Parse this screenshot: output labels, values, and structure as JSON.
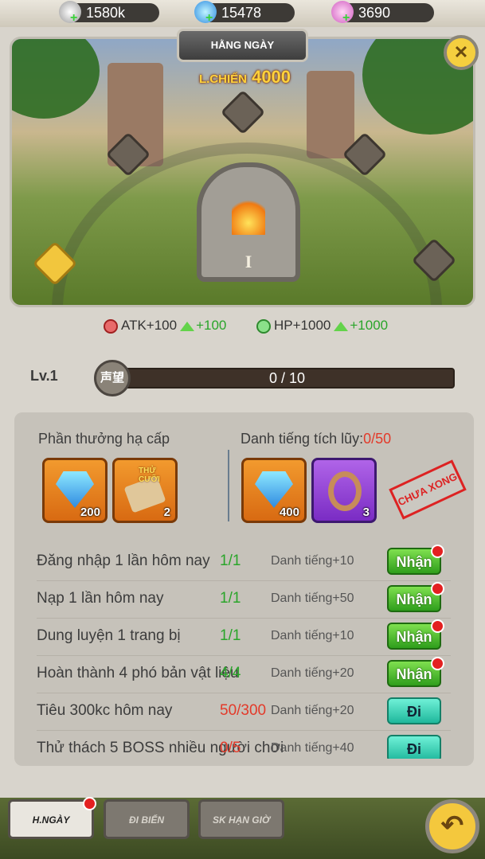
{
  "currencies": [
    {
      "name": "silver-coin",
      "value": "1580k",
      "color": "#b9b9b9"
    },
    {
      "name": "diamond",
      "value": "15478",
      "color": "#3aa7e8"
    },
    {
      "name": "shell",
      "value": "3690",
      "color": "#e98ad6"
    }
  ],
  "header": {
    "title": "HẰNG NGÀY",
    "power_label": "L.CHIẾN",
    "power_value": "4000"
  },
  "scene": {
    "stage_numeral": "I"
  },
  "stats": {
    "atk_label": "ATK+100",
    "atk_bonus": "+100",
    "hp_label": "HP+1000",
    "hp_bonus": "+1000"
  },
  "progress": {
    "level": "Lv.1",
    "badge": "声望",
    "text": "0 / 10",
    "value": 0,
    "max": 10
  },
  "rewards": {
    "lower_title": "Phần thưởng hạ cấp",
    "lower_items": [
      {
        "icon": "diamond-icon",
        "count": "200"
      },
      {
        "icon": "scroll-icon",
        "count": "2",
        "tag": "THỬ CƯỠI"
      }
    ],
    "accum_title": "Danh tiếng tích lũy:",
    "accum_progress": "0/50",
    "accum_items": [
      {
        "icon": "diamond-icon",
        "count": "400"
      },
      {
        "icon": "rope-icon",
        "count": "3"
      }
    ],
    "stamp": "CHƯA XONG"
  },
  "tasks": [
    {
      "desc": "Đăng nhập 1 lần hôm nay",
      "progress": "1/1",
      "reward": "Danh tiếng+10",
      "button": "Nhận",
      "done": true
    },
    {
      "desc": "Nạp 1 lần hôm nay",
      "progress": "1/1",
      "reward": "Danh tiếng+50",
      "button": "Nhận",
      "done": true
    },
    {
      "desc": "Dung luyện 1 trang bị",
      "progress": "1/1",
      "reward": "Danh tiếng+10",
      "button": "Nhận",
      "done": true
    },
    {
      "desc": "Hoàn thành 4 phó bản vật liệu",
      "progress": "4/4",
      "reward": "Danh tiếng+20",
      "button": "Nhận",
      "done": true
    },
    {
      "desc": "Tiêu 300kc hôm nay",
      "progress": "50/300",
      "reward": "Danh tiếng+20",
      "button": "Đi",
      "done": false
    },
    {
      "desc": "Thử thách 5 BOSS nhiều người chơi",
      "progress": "0/5",
      "reward": "Danh tiếng+40",
      "button": "Đi",
      "done": false
    }
  ],
  "tabs": [
    {
      "label": "H.NGÀY",
      "active": true
    },
    {
      "label": "ĐI BIỂN",
      "active": false
    },
    {
      "label": "SK HẠN GIỜ",
      "active": false
    }
  ],
  "colors": {
    "done": "#2aa52a",
    "pending": "#e33a2a",
    "accent": "#f4c83d"
  }
}
